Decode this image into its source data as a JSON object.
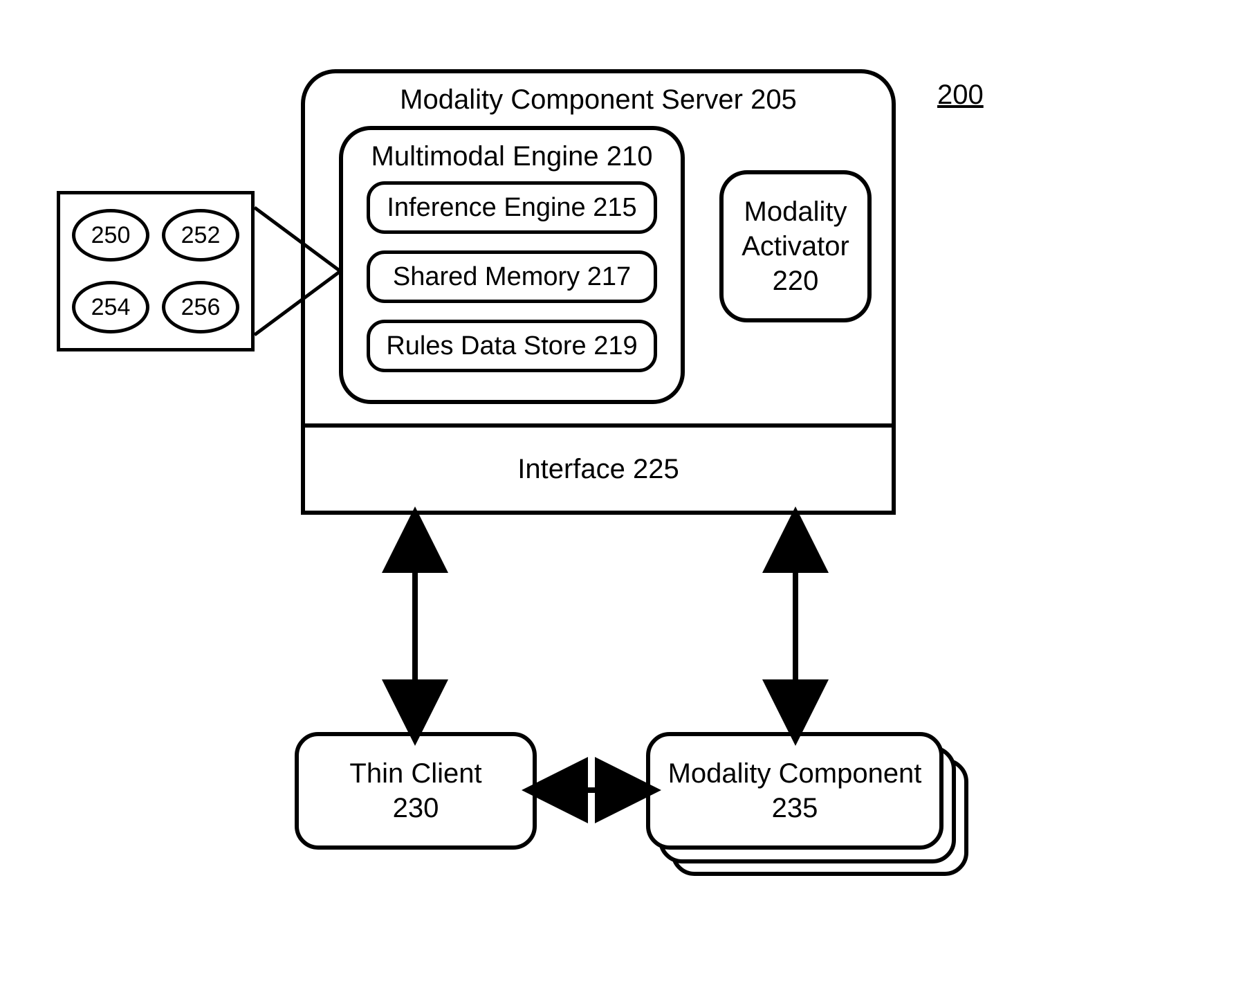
{
  "figureNumber": "200",
  "server": {
    "title": "Modality Component Server 205"
  },
  "engine": {
    "title": "Multimodal Engine 210",
    "inference": "Inference Engine 215",
    "sharedMemory": "Shared Memory 217",
    "rulesStore": "Rules Data Store 219"
  },
  "activator": {
    "line1": "Modality",
    "line2": "Activator",
    "line3": "220"
  },
  "interface": {
    "label": "Interface 225"
  },
  "callout": {
    "n1": "250",
    "n2": "252",
    "n3": "254",
    "n4": "256"
  },
  "thinClient": {
    "line1": "Thin Client",
    "line2": "230"
  },
  "modalityComponent": {
    "line1": "Modality Component",
    "line2": "235"
  }
}
